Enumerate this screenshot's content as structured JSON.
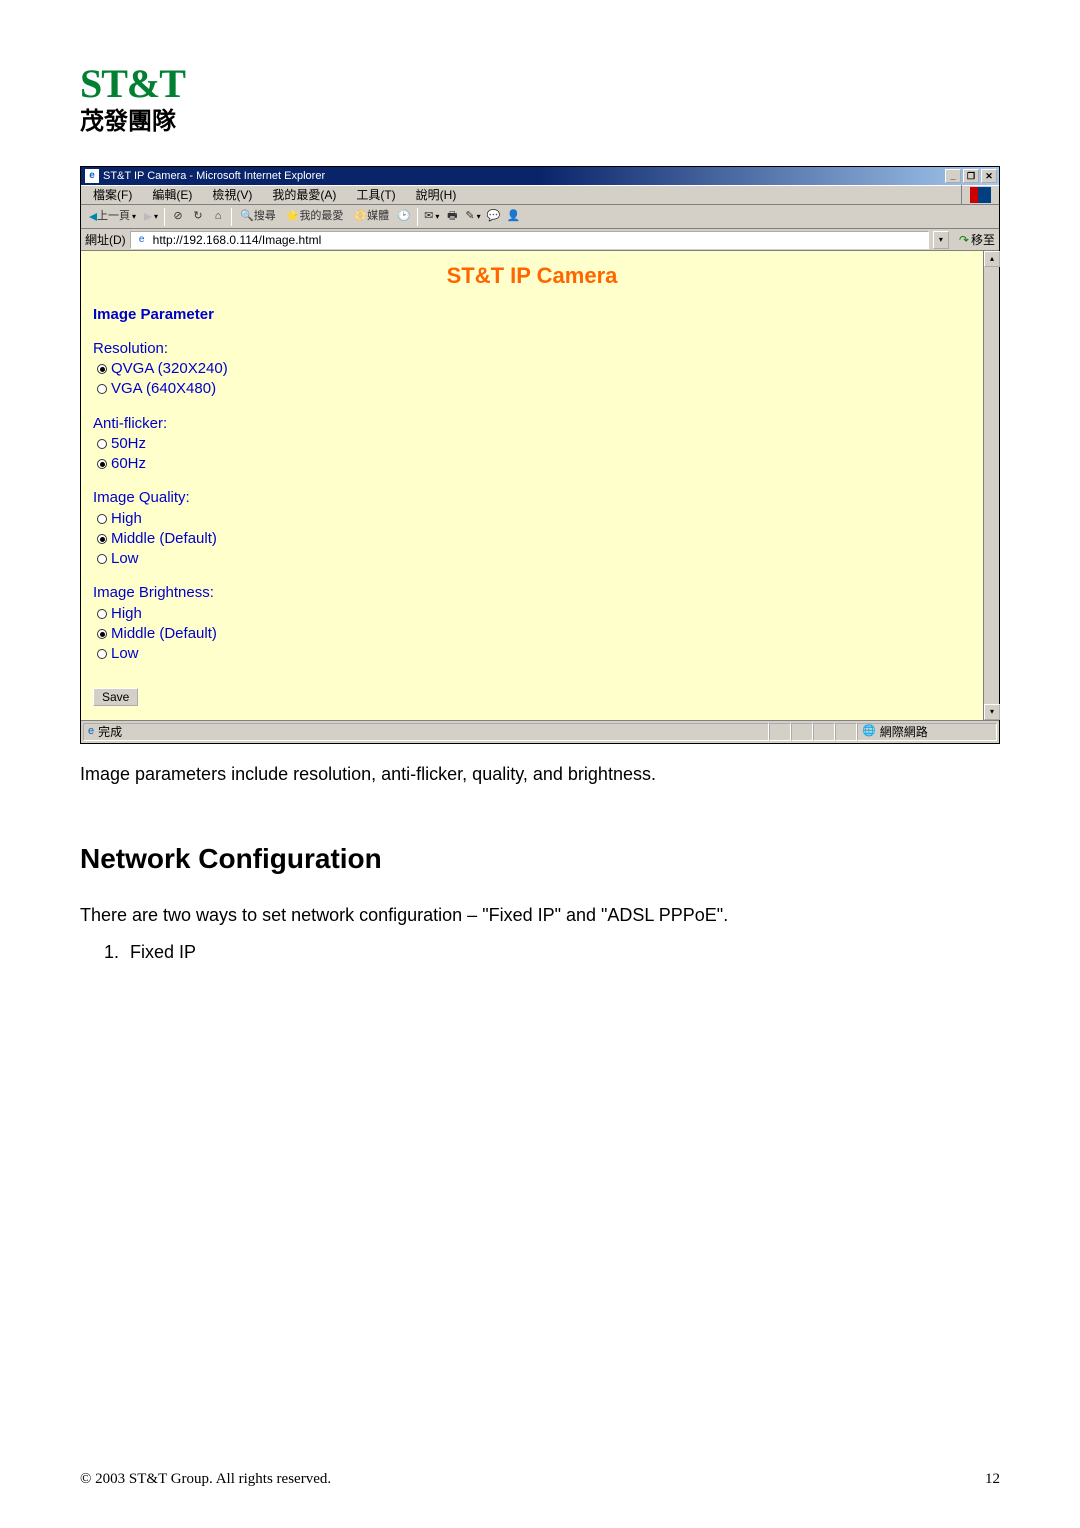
{
  "logo": {
    "brand": "ST&T",
    "tagline": "茂發團隊"
  },
  "ie": {
    "title": "ST&T IP Camera - Microsoft Internet Explorer",
    "window_controls": {
      "min": "_",
      "restore": "❐",
      "close": "✕"
    },
    "menu": [
      "檔案(F)",
      "編輯(E)",
      "檢視(V)",
      "我的最愛(A)",
      "工具(T)",
      "說明(H)"
    ],
    "toolbar": {
      "back": "上一頁",
      "search": "搜尋",
      "favorites": "我的最愛",
      "media": "媒體"
    },
    "address": {
      "label": "網址(D)",
      "url": "http://192.168.0.114/Image.html",
      "go": "移至"
    },
    "status": {
      "done": "完成",
      "zone": "網際網路"
    }
  },
  "content": {
    "title": "ST&T IP Camera",
    "section": "Image Parameter",
    "resolution": {
      "label": "Resolution:",
      "options": [
        "QVGA (320X240)",
        "VGA (640X480)"
      ],
      "selected": 0
    },
    "antiflicker": {
      "label": "Anti-flicker:",
      "options": [
        "50Hz",
        "60Hz"
      ],
      "selected": 1
    },
    "quality": {
      "label": "Image Quality:",
      "options": [
        "High",
        "Middle (Default)",
        "Low"
      ],
      "selected": 1
    },
    "brightness": {
      "label": "Image Brightness:",
      "options": [
        "High",
        "Middle (Default)",
        "Low"
      ],
      "selected": 1
    },
    "save": "Save"
  },
  "doc": {
    "caption": "Image parameters include resolution, anti-flicker, quality, and brightness.",
    "heading": "Network Configuration",
    "intro": "There are two ways to set network configuration – \"Fixed IP\" and \"ADSL PPPoE\".",
    "list": [
      "Fixed IP"
    ],
    "footer": "© 2003 ST&T Group. All rights reserved.",
    "pagenum": "12"
  }
}
